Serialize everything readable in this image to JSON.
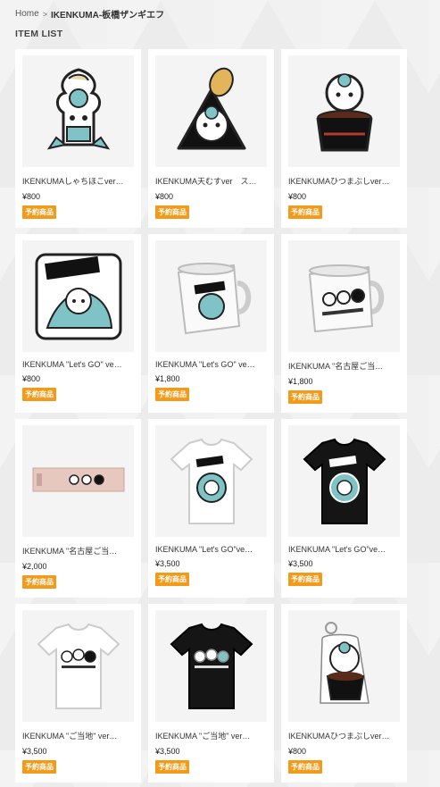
{
  "breadcrumb": {
    "home": "Home",
    "separator": ">",
    "current": "IKENKUMA-板橋ザンギエフ"
  },
  "section_title": "ITEM LIST",
  "colors": {
    "badge": "#f39a18",
    "accent_teal": "#3f8f8c"
  },
  "items": [
    {
      "name": "IKENKUMAしゃちほこver…",
      "price": "¥800",
      "badge": "予約商品",
      "icon": "sticker-shachihoko"
    },
    {
      "name": "IKENKUMA天むすver　ス…",
      "price": "¥800",
      "badge": "予約商品",
      "icon": "sticker-tenmusu"
    },
    {
      "name": "IKENKUMAひつまぶしver…",
      "price": "¥800",
      "badge": "予約商品",
      "icon": "sticker-hitsumabushi"
    },
    {
      "name": "IKENKUMA \"Let's GO\" ve…",
      "price": "¥800",
      "badge": "予約商品",
      "icon": "sticker-lets-go"
    },
    {
      "name": "IKENKUMA \"Let's GO\" ve…",
      "price": "¥1,800",
      "badge": "予約商品",
      "icon": "mug-lets-go"
    },
    {
      "name": "IKENKUMA \"名古屋ご当…",
      "price": "¥1,800",
      "badge": "予約商品",
      "icon": "mug-nagoya"
    },
    {
      "name": "IKENKUMA \"名古屋ご当…",
      "price": "¥2,000",
      "badge": "予約商品",
      "icon": "towel-nagoya"
    },
    {
      "name": "IKENKUMA \"Let's GO\"ve…",
      "price": "¥3,500",
      "badge": "予約商品",
      "icon": "tshirt-white-lets-go"
    },
    {
      "name": "IKENKUMA \"Let's GO\"ve…",
      "price": "¥3,500",
      "badge": "予約商品",
      "icon": "tshirt-black-lets-go"
    },
    {
      "name": "IKENKUMA \"ご当地\" ver…",
      "price": "¥3,500",
      "badge": "予約商品",
      "icon": "tshirt-white-gotouchi"
    },
    {
      "name": "IKENKUMA \"ご当地\" ver…",
      "price": "¥3,500",
      "badge": "予約商品",
      "icon": "tshirt-black-gotouchi"
    },
    {
      "name": "IKENKUMAひつまぶしver…",
      "price": "¥800",
      "badge": "予約商品",
      "icon": "keychain-hitsumabushi"
    }
  ]
}
